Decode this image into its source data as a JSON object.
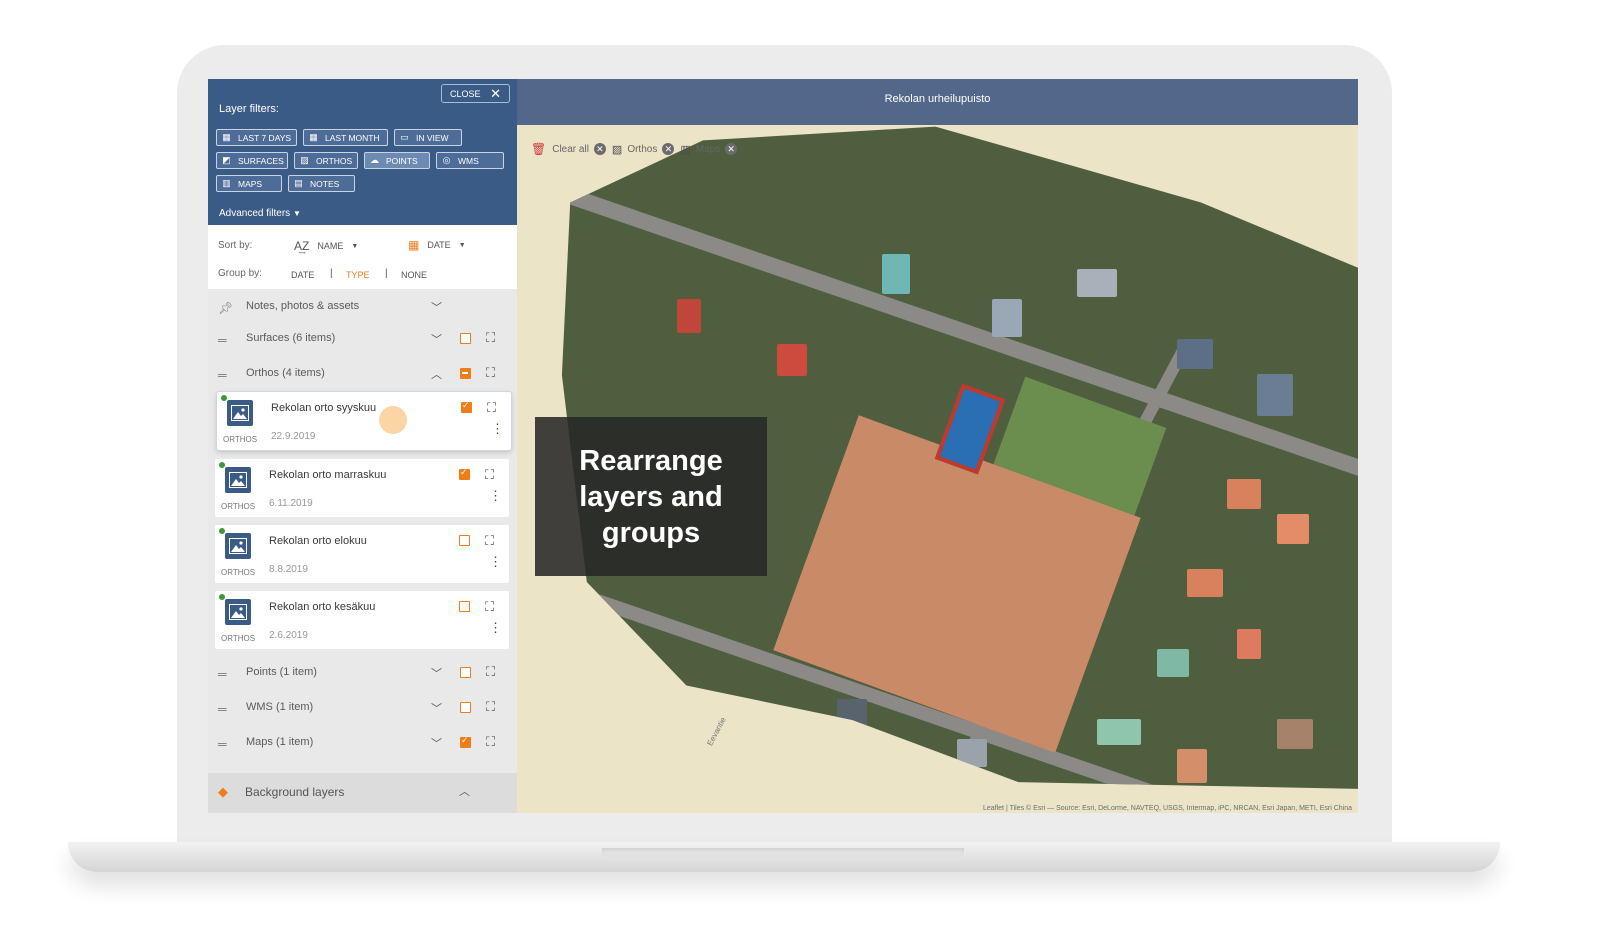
{
  "panel": {
    "close_label": "CLOSE",
    "layer_filters_title": "Layer filters:",
    "filter_chips": [
      {
        "label": "LAST 7 DAYS",
        "icon": "calendar-icon"
      },
      {
        "label": "LAST MONTH",
        "icon": "calendar-icon"
      },
      {
        "label": "IN VIEW",
        "icon": "monitor-icon"
      },
      {
        "label": "SURFACES",
        "icon": "surface-icon"
      },
      {
        "label": "ORTHOS",
        "icon": "image-icon"
      },
      {
        "label": "POINTS",
        "icon": "cloud-icon"
      },
      {
        "label": "WMS",
        "icon": "globe-icon"
      },
      {
        "label": "MAPS",
        "icon": "map-icon"
      },
      {
        "label": "NOTES",
        "icon": "note-icon"
      }
    ],
    "advanced_filters_label": "Advanced filters",
    "sort_by_label": "Sort by:",
    "sort_options": [
      "NAME",
      "DATE"
    ],
    "group_by_label": "Group by:",
    "group_options": [
      "DATE",
      "TYPE",
      "NONE"
    ],
    "group_by_selected": "TYPE",
    "groups": [
      {
        "label": "Notes, photos & assets"
      },
      {
        "label": "Surfaces (6 items)"
      },
      {
        "label": "Orthos (4 items)"
      },
      {
        "label": "Points (1 item)"
      },
      {
        "label": "WMS (1 item)"
      },
      {
        "label": "Maps (1 item)"
      }
    ],
    "ortho_items": [
      {
        "name": "Rekolan orto syyskuu",
        "date": "22.9.2019",
        "type": "ORTHOS",
        "checked": true
      },
      {
        "name": "Rekolan orto marraskuu",
        "date": "6.11.2019",
        "type": "ORTHOS",
        "checked": true
      },
      {
        "name": "Rekolan orto elokuu",
        "date": "8.8.2019",
        "type": "ORTHOS",
        "checked": false
      },
      {
        "name": "Rekolan orto kesäkuu",
        "date": "2.6.2019",
        "type": "ORTHOS",
        "checked": false
      }
    ],
    "background_layers_label": "Background layers"
  },
  "map": {
    "title": "Rekolan urheilupuisto",
    "clear_all_label": "Clear all",
    "active_filters": [
      "Orthos",
      "Maps"
    ],
    "overlay_text_lines": [
      "Rearrange",
      "layers and",
      "groups"
    ],
    "street_name": "Eevantie",
    "attribution": "Leaflet | Tiles © Esri — Source: Esri, DeLorme, NAVTEQ, USGS, Intermap, iPC, NRCAN, Esri Japan, METI, Esri China"
  },
  "colors": {
    "panel_header": "#3b5b87",
    "accent_orange": "#ef7d1a",
    "map_bar": "#53678a"
  }
}
